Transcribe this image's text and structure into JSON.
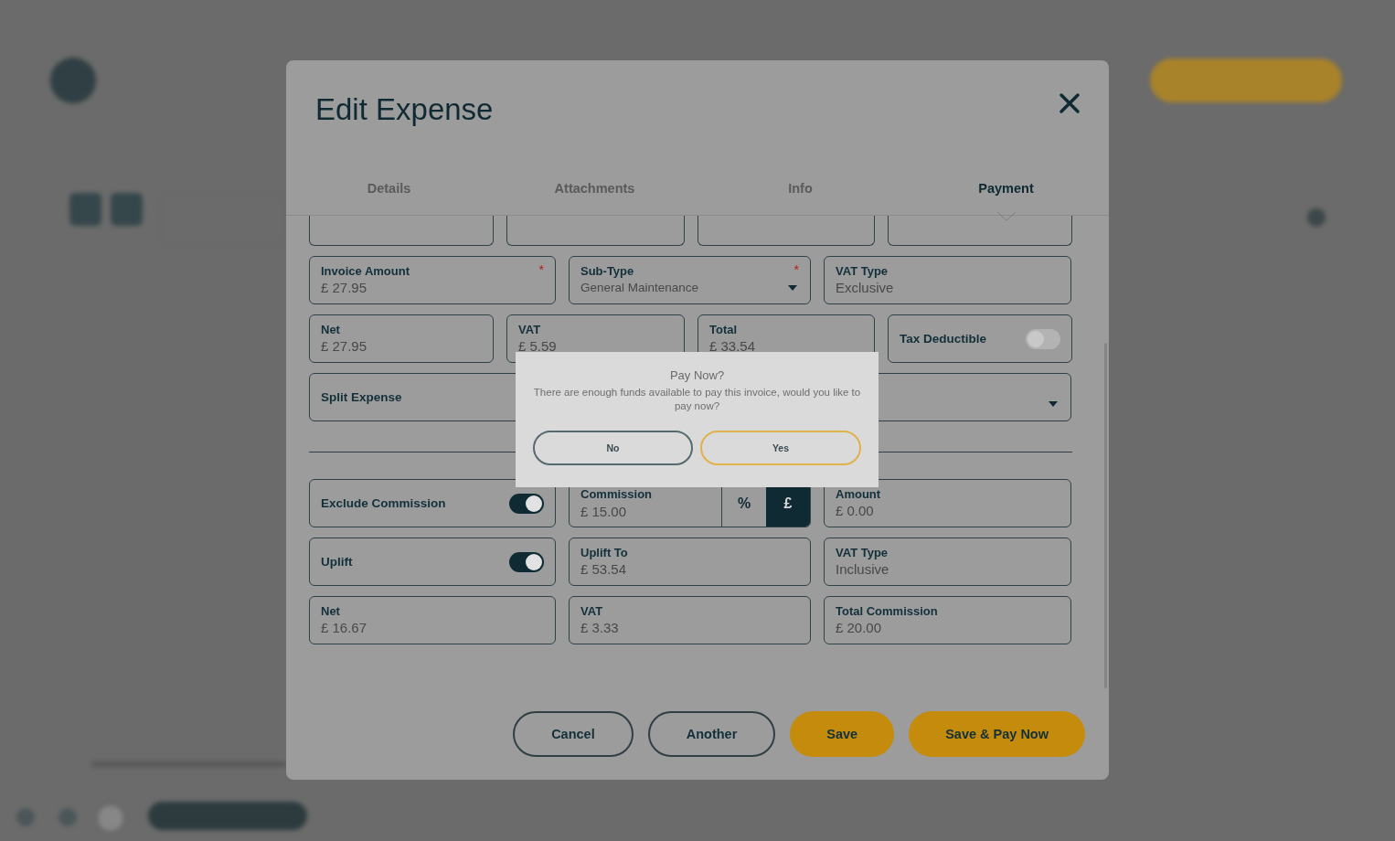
{
  "modal": {
    "title": "Edit Expense",
    "tabs": [
      {
        "label": "Details",
        "selected": false
      },
      {
        "label": "Attachments",
        "selected": false
      },
      {
        "label": "Info",
        "selected": false
      },
      {
        "label": "Payment",
        "selected": true
      }
    ],
    "rows": [
      {
        "kind": "partial",
        "fields": [
          {
            "kind": "blank"
          },
          {
            "kind": "blank"
          },
          {
            "kind": "blank"
          },
          {
            "kind": "blank"
          }
        ]
      },
      {
        "kind": "fields",
        "fields": [
          {
            "kind": "input",
            "label": "Invoice Amount",
            "value": "£ 27.95",
            "required_mark": "*"
          },
          {
            "kind": "select",
            "label": "Sub-Type",
            "value": "General Maintenance",
            "required_mark": "*"
          },
          {
            "kind": "input",
            "label": "VAT Type",
            "value": "Exclusive"
          }
        ]
      },
      {
        "kind": "fields",
        "fields": [
          {
            "kind": "input",
            "label": "Net",
            "value": "£ 27.95"
          },
          {
            "kind": "input",
            "label": "VAT",
            "value": "£ 5.59"
          },
          {
            "kind": "input",
            "label": "Total",
            "value": "£ 33.54"
          },
          {
            "kind": "toggle",
            "label": "Tax Deductible",
            "on": false
          }
        ]
      },
      {
        "kind": "fields",
        "fields": [
          {
            "kind": "toggle",
            "label": "Split Expense"
          },
          {
            "kind": "select"
          }
        ]
      },
      {
        "kind": "divider"
      },
      {
        "kind": "fields",
        "fields": [
          {
            "kind": "toggle",
            "label": "Exclude Commission",
            "on": true
          },
          {
            "kind": "segmented",
            "label": "Commission",
            "value": "£ 15.00",
            "options": [
              {
                "label": "%",
                "selected": false
              },
              {
                "label": "£",
                "selected": true
              }
            ]
          },
          {
            "kind": "input",
            "label": "Amount",
            "value": "£ 0.00"
          }
        ]
      },
      {
        "kind": "fields",
        "fields": [
          {
            "kind": "toggle",
            "label": "Uplift",
            "on": true
          },
          {
            "kind": "input",
            "label": "Uplift To",
            "value": "£ 53.54"
          },
          {
            "kind": "input",
            "label": "VAT Type",
            "value": "Inclusive"
          }
        ]
      },
      {
        "kind": "fields",
        "fields": [
          {
            "kind": "input",
            "label": "Net",
            "value": "£ 16.67"
          },
          {
            "kind": "input",
            "label": "VAT",
            "value": "£ 3.33"
          },
          {
            "kind": "input",
            "label": "Total Commission",
            "value": "£ 20.00"
          }
        ]
      }
    ],
    "buttons": [
      {
        "label": "Cancel",
        "kind": "outline"
      },
      {
        "label": "Another",
        "kind": "outline"
      },
      {
        "label": "Save",
        "kind": "primary"
      },
      {
        "label": "Save & Pay Now",
        "kind": "primary"
      }
    ]
  },
  "dialog": {
    "title": "Pay Now?",
    "message": "There are enough funds available to pay this invoice, would you like to pay now?",
    "buttons": [
      {
        "label": "No",
        "kind": "secondary"
      },
      {
        "label": "Yes",
        "kind": "primary"
      }
    ]
  }
}
